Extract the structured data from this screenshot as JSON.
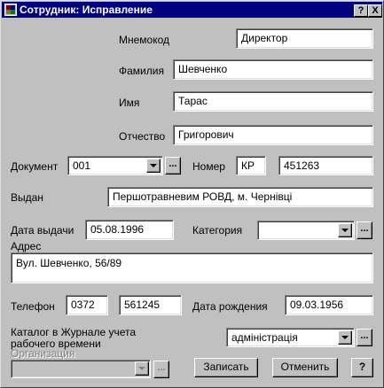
{
  "window": {
    "title": "Сотрудник: Исправление",
    "help_btn": "?",
    "close_btn": "X"
  },
  "form": {
    "mnemo": {
      "label": "Мнемокод",
      "value": "Директор"
    },
    "surname": {
      "label": "Фамилия",
      "value": "Шевченко"
    },
    "name": {
      "label": "Имя",
      "value": "Тарас"
    },
    "patronymic": {
      "label": "Отчество",
      "value": "Григорович"
    },
    "document": {
      "label": "Документ",
      "value": "001"
    },
    "number": {
      "label": "Номер",
      "series": "КР",
      "value": "451263"
    },
    "issued": {
      "label": "Выдан",
      "value": "Першотравневим РОВД, м. Чернівці"
    },
    "issue_date": {
      "label": "Дата выдачи",
      "value": "05.08.1996"
    },
    "category": {
      "label": "Категория",
      "value": ""
    },
    "address": {
      "label": "Адрес",
      "value": "Вул. Шевченко, 56/89"
    },
    "phone": {
      "label": "Телефон",
      "code": "0372",
      "value": "561245"
    },
    "birth_date": {
      "label": "Дата рождения",
      "value": "09.03.1956"
    },
    "catalog": {
      "label_line1": "Каталог в Журнале учета",
      "label_line2": "рабочего времени",
      "value": "адміністрація"
    },
    "organization": {
      "label": "Организация",
      "value": ""
    }
  },
  "buttons": {
    "ellipsis": "...",
    "save": "Записать",
    "cancel": "Отменить",
    "help": "?"
  }
}
